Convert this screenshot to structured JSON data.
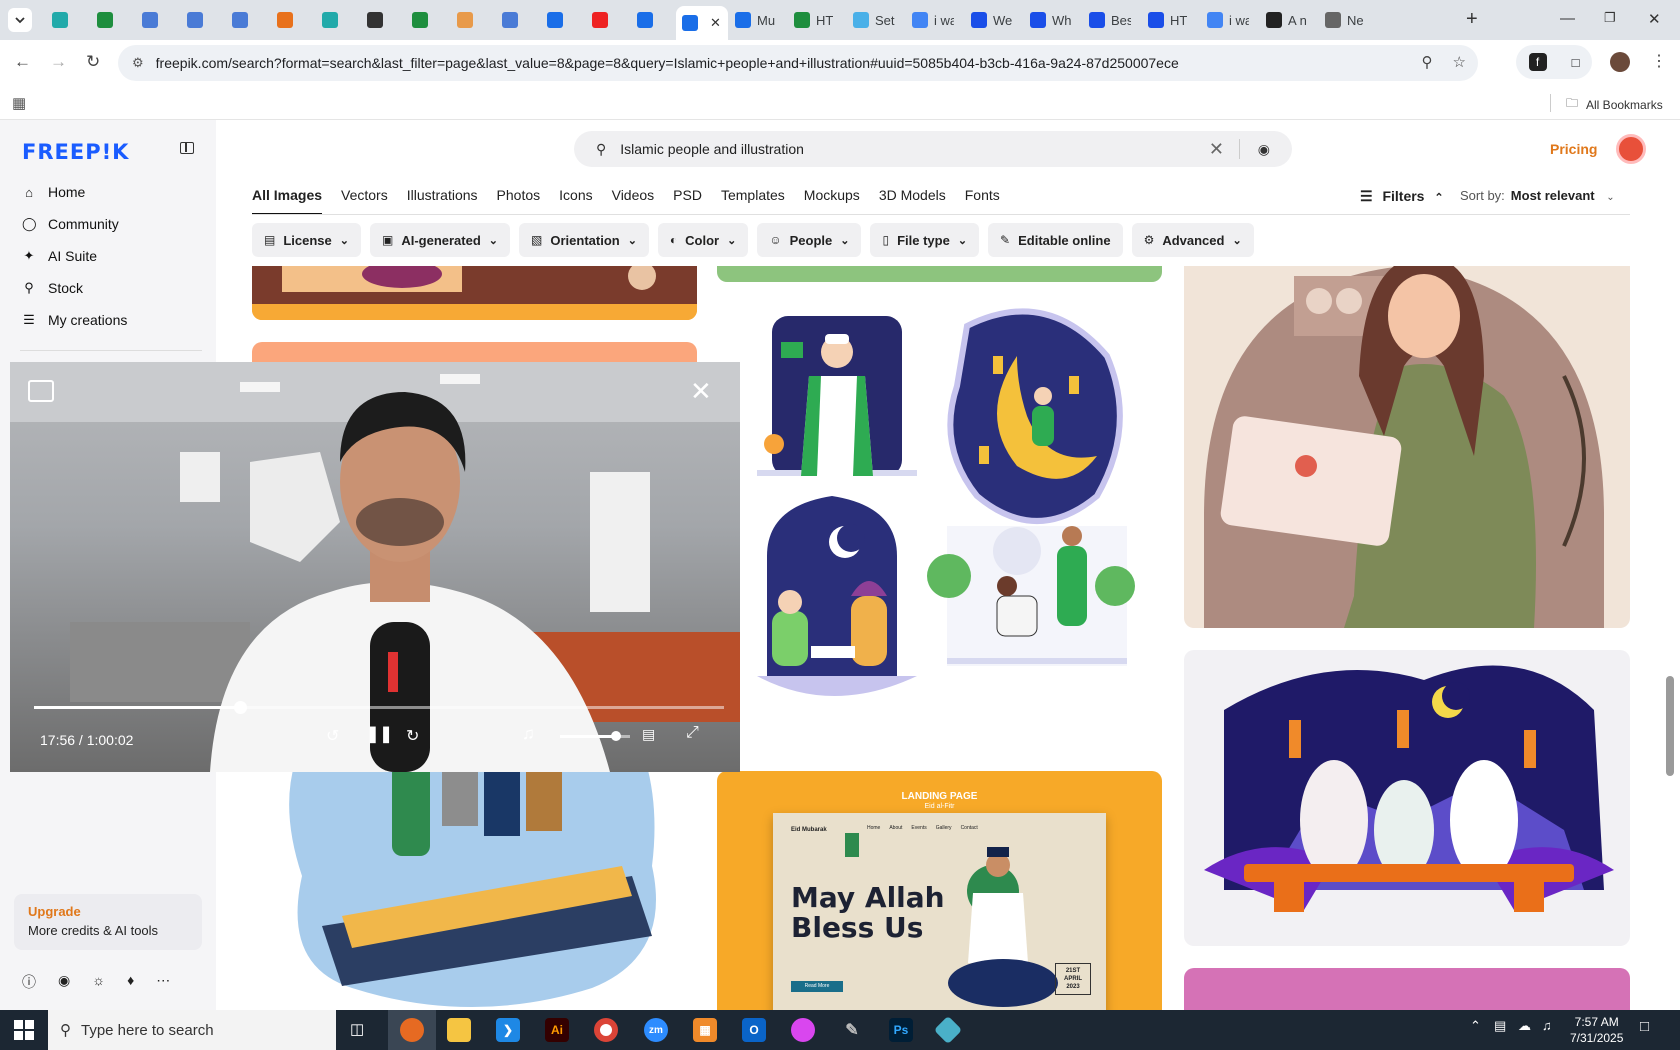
{
  "browser": {
    "tabs": [
      {
        "title": "",
        "color": "#2aa"
      },
      {
        "title": "",
        "color": "#1e8e3e"
      },
      {
        "title": "",
        "color": "#4a7bd6"
      },
      {
        "title": "",
        "color": "#4a7bd6"
      },
      {
        "title": "",
        "color": "#4a7bd6"
      },
      {
        "title": "",
        "color": "#e8711c"
      },
      {
        "title": "",
        "color": "#2aa"
      },
      {
        "title": "",
        "color": "#333"
      },
      {
        "title": "",
        "color": "#1e8e3e"
      },
      {
        "title": "",
        "color": "#e89a4a"
      },
      {
        "title": "",
        "color": "#4a7bd6"
      },
      {
        "title": "",
        "color": "#1a6ee8"
      },
      {
        "title": "",
        "color": "#e22"
      },
      {
        "title": "",
        "color": "#1a6ee8"
      },
      {
        "title": "",
        "color": "#1a6ee8",
        "active": true
      },
      {
        "title": "Mu",
        "color": "#1a6ee8"
      },
      {
        "title": "HT",
        "color": "#1e8e3e"
      },
      {
        "title": "Set",
        "color": "#4ab0e8"
      },
      {
        "title": "i wa",
        "color": "#4285f4"
      },
      {
        "title": "We",
        "color": "#1a4ee8"
      },
      {
        "title": "Wh",
        "color": "#1a4ee8"
      },
      {
        "title": "Bes",
        "color": "#1a4ee8"
      },
      {
        "title": "HT",
        "color": "#1a4ee8"
      },
      {
        "title": "i wa",
        "color": "#4285f4"
      },
      {
        "title": "A n",
        "color": "#222"
      },
      {
        "title": "Ne",
        "color": "#666"
      }
    ],
    "url": "freepik.com/search?format=search&last_filter=page&last_value=8&page=8&query=Islamic+people+and+illustration#uuid=5085b404-b3cb-416a-9a24-87d250007ece",
    "all_bookmarks": "All Bookmarks"
  },
  "sidebar": {
    "logo": "FREEP!K",
    "nav": [
      {
        "label": "Home",
        "icon": "home-icon"
      },
      {
        "label": "Community",
        "icon": "globe-icon"
      },
      {
        "label": "AI Suite",
        "icon": "sparkle-icon"
      },
      {
        "label": "Stock",
        "icon": "search-icon"
      },
      {
        "label": "My creations",
        "icon": "layers-icon"
      }
    ],
    "upgrade_title": "Upgrade",
    "upgrade_sub": "More credits & AI tools"
  },
  "header": {
    "search_query": "Islamic people and illustration",
    "pricing": "Pricing"
  },
  "tabs": [
    "All Images",
    "Vectors",
    "Illustrations",
    "Photos",
    "Icons",
    "Videos",
    "PSD",
    "Templates",
    "Mockups",
    "3D Models",
    "Fonts"
  ],
  "active_tab": "All Images",
  "filters_label": "Filters",
  "sort_label": "Sort by:",
  "sort_value": "Most relevant",
  "chips": [
    {
      "label": "License",
      "icon": "license-icon"
    },
    {
      "label": "AI-generated",
      "icon": "ai-icon"
    },
    {
      "label": "Orientation",
      "icon": "orientation-icon"
    },
    {
      "label": "Color",
      "icon": "palette-icon"
    },
    {
      "label": "People",
      "icon": "people-icon"
    },
    {
      "label": "File type",
      "icon": "file-icon"
    },
    {
      "label": "Editable online",
      "icon": "pen-icon"
    },
    {
      "label": "Advanced",
      "icon": "gear-icon"
    }
  ],
  "cards": {
    "landing_label": "LANDING PAGE",
    "landing_sub": "Eid al-Fitr",
    "landing_brand": "Eid Mubarak",
    "landing_menu": [
      "Home",
      "About",
      "Events",
      "Gallery",
      "Contact"
    ],
    "landing_headline_1": "May Allah",
    "landing_headline_2": "Bless Us",
    "landing_button": "Read More",
    "landing_date_1": "21ST",
    "landing_date_2": "APRIL",
    "landing_date_3": "2023"
  },
  "video": {
    "time": "17:56 / 1:00:02",
    "progress": 0.299,
    "volume": 0.8
  },
  "taskbar": {
    "search_placeholder": "Type here to search",
    "time": "7:57 AM",
    "date": "7/31/2025"
  }
}
